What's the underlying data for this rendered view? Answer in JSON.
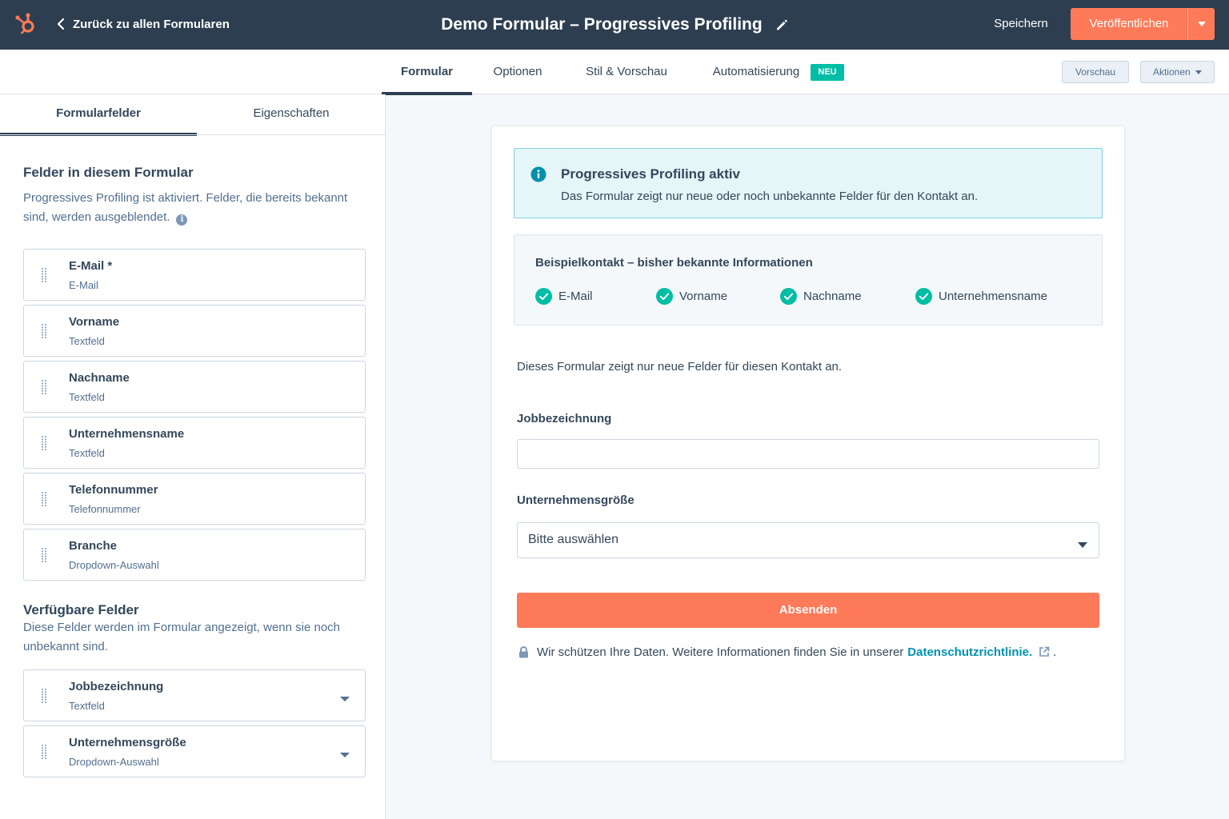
{
  "header": {
    "back_label": "Zurück zu allen Formularen",
    "title": "Demo Formular – Progressives Profiling",
    "save_label": "Speichern",
    "publish_label": "Veröffentlichen"
  },
  "nav": {
    "tabs": [
      {
        "label": "Formular"
      },
      {
        "label": "Optionen"
      },
      {
        "label": "Stil & Vorschau"
      },
      {
        "label": "Automatisierung"
      }
    ],
    "new_badge": "NEU",
    "preview_label": "Vorschau",
    "actions_label": "Aktionen"
  },
  "sidebar": {
    "tabs": [
      {
        "label": "Formularfelder"
      },
      {
        "label": "Eigenschaften"
      }
    ],
    "form_fields_title": "Felder in diesem Formular",
    "form_fields_desc": "Progressives Profiling ist aktiviert. Felder, die bereits bekannt sind, werden ausgeblendet.",
    "info_glyph": "i",
    "fields": [
      {
        "name": "E-Mail *",
        "type": "E-Mail"
      },
      {
        "name": "Vorname",
        "type": "Textfeld"
      },
      {
        "name": "Nachname",
        "type": "Textfeld"
      },
      {
        "name": "Unternehmensname",
        "type": "Textfeld"
      },
      {
        "name": "Telefonnummer",
        "type": "Telefonnummer"
      },
      {
        "name": "Branche",
        "type": "Dropdown-Auswahl"
      }
    ],
    "available_title": "Verfügbare Felder",
    "available_desc": "Diese Felder werden im Formular angezeigt, wenn sie noch unbekannt sind.",
    "available_fields": [
      {
        "name": "Jobbezeichnung",
        "type": "Textfeld"
      },
      {
        "name": "Unternehmensgröße",
        "type": "Dropdown-Auswahl"
      }
    ]
  },
  "preview": {
    "alert_title": "Progressives Profiling aktiv",
    "alert_text": "Das Formular zeigt nur neue oder noch unbekannte Felder für den Kontakt an.",
    "known_title": "Beispielkontakt – bisher bekannte Informationen",
    "known_items": [
      "E-Mail",
      "Vorname",
      "Nachname",
      "Unternehmensname"
    ],
    "form_note": "Dieses Formular zeigt nur neue Felder für diesen Kontakt an.",
    "job_label": "Jobbezeichnung",
    "job_value": "",
    "size_label": "Unternehmensgröße",
    "size_value": "Bitte auswählen",
    "submit_label": "Absenden",
    "privacy_text": "Wir schützen Ihre Daten. Weitere Informationen finden Sie in unserer",
    "privacy_link": "Datenschutzrichtlinie.",
    "privacy_end": "."
  },
  "colors": {
    "topbar": "#2d3e50",
    "accent": "#ff7a59",
    "success": "#00bda5",
    "link": "#0091ae",
    "info": "#0091ae"
  }
}
